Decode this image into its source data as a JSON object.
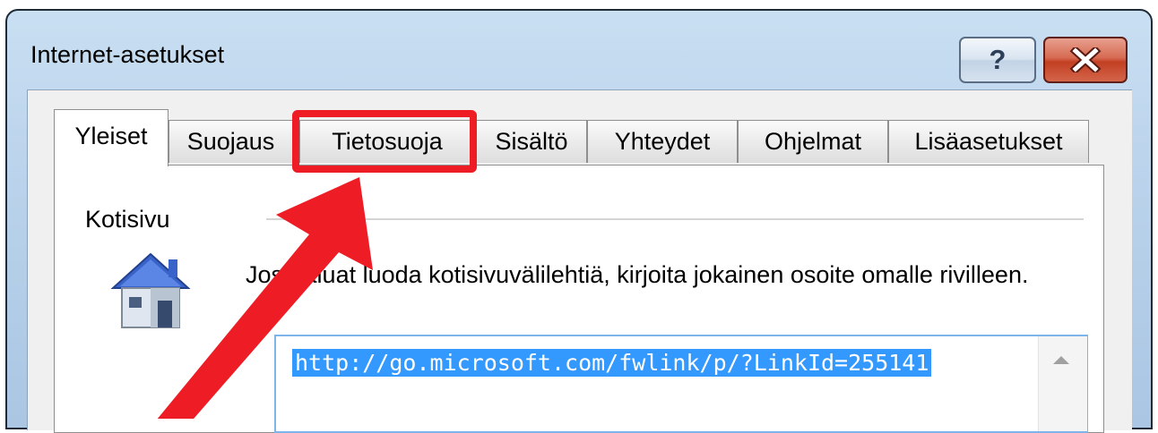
{
  "window": {
    "title": "Internet-asetukset",
    "help_label": "?",
    "help_icon": "question-mark-icon",
    "close_icon": "close-x-icon"
  },
  "tabs": [
    {
      "label": "Yleiset",
      "active": true
    },
    {
      "label": "Suojaus",
      "active": false
    },
    {
      "label": "Tietosuoja",
      "active": false,
      "highlighted": true
    },
    {
      "label": "Sisältö",
      "active": false
    },
    {
      "label": "Yhteydet",
      "active": false
    },
    {
      "label": "Ohjelmat",
      "active": false
    },
    {
      "label": "Lisäasetukset",
      "active": false
    }
  ],
  "homepage": {
    "group_label": "Kotisivu",
    "icon": "house-icon",
    "description": "Jos haluat luoda kotisivuvälilehtiä, kirjoita jokainen osoite omalle rivilleen.",
    "url": "http://go.microsoft.com/fwlink/p/?LinkId=255141"
  },
  "annotation": {
    "highlight_color": "#ee1c25",
    "arrow_color": "#ee1c25"
  }
}
